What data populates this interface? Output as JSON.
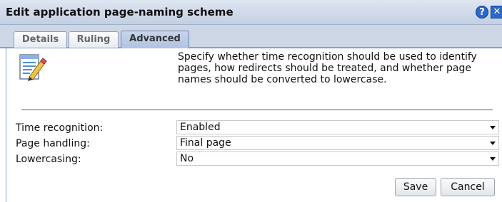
{
  "dialog": {
    "title": "Edit application page-naming scheme",
    "help_glyph": "?",
    "close_glyph": "✕"
  },
  "tabs": [
    {
      "label": "Details",
      "active": false
    },
    {
      "label": "Ruling",
      "active": false
    },
    {
      "label": "Advanced",
      "active": true
    }
  ],
  "content": {
    "icon": "document-edit-icon",
    "description": "Specify whether time recognition should be used to identify pages, how redirects should be treated, and whether page names should be converted to lowercase."
  },
  "fields": [
    {
      "label": "Time recognition:",
      "value": "Enabled"
    },
    {
      "label": "Page handling:",
      "value": "Final page"
    },
    {
      "label": "Lowercasing:",
      "value": "No"
    }
  ],
  "buttons": {
    "save": "Save",
    "cancel": "Cancel"
  },
  "colors": {
    "titlebar": "#c3cfe2",
    "active_tab": "#b0c3e2",
    "accent": "#2b68c8"
  }
}
